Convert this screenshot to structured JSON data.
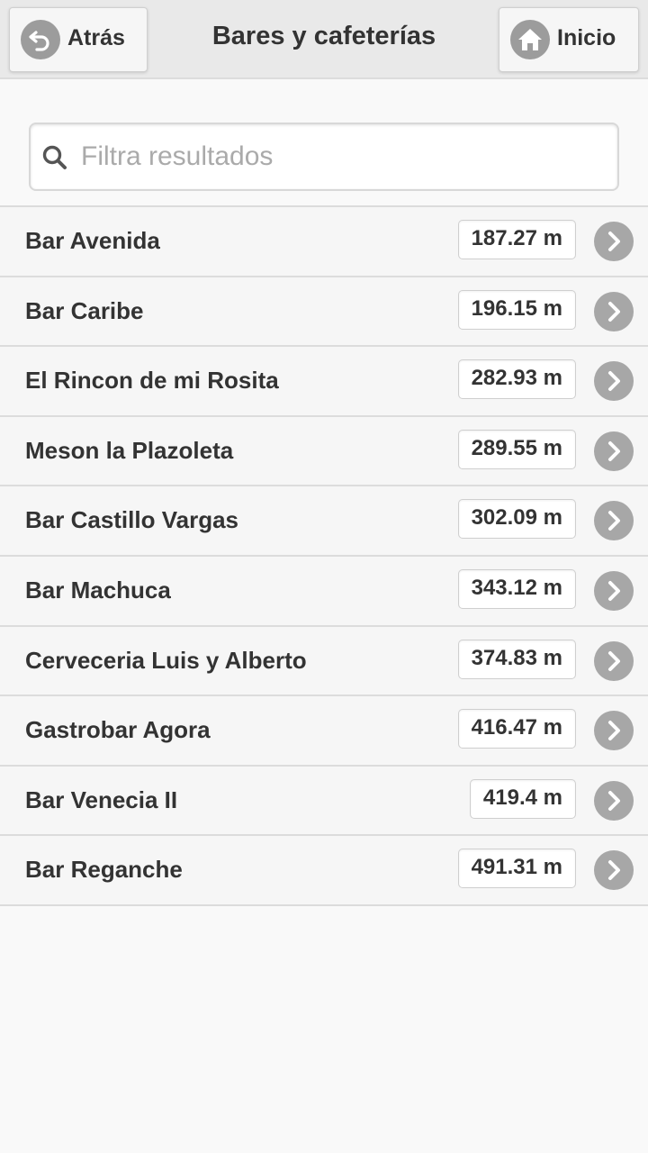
{
  "header": {
    "title": "Bares y cafeterías",
    "back_label": "Atrás",
    "home_label": "Inicio"
  },
  "search": {
    "placeholder": "Filtra resultados",
    "value": ""
  },
  "icons": {
    "back": "back-arrow-icon",
    "home": "home-icon",
    "search": "search-icon",
    "row_arrow": "chevron-right-icon"
  },
  "colors": {
    "header_bg": "#e9e9e9",
    "icon_circle": "#9c9c9c",
    "text": "#333333",
    "placeholder": "#aaaaaa"
  },
  "places": [
    {
      "name": "Bar Avenida",
      "distance": "187.27 m"
    },
    {
      "name": "Bar Caribe",
      "distance": "196.15 m"
    },
    {
      "name": "El Rincon de mi Rosita",
      "distance": "282.93 m"
    },
    {
      "name": "Meson la Plazoleta",
      "distance": "289.55 m"
    },
    {
      "name": "Bar Castillo Vargas",
      "distance": "302.09 m"
    },
    {
      "name": "Bar Machuca",
      "distance": "343.12 m"
    },
    {
      "name": "Cerveceria Luis y Alberto",
      "distance": "374.83 m"
    },
    {
      "name": "Gastrobar Agora",
      "distance": "416.47 m"
    },
    {
      "name": "Bar Venecia II",
      "distance": "419.4 m"
    },
    {
      "name": "Bar Reganche",
      "distance": "491.31 m"
    }
  ]
}
